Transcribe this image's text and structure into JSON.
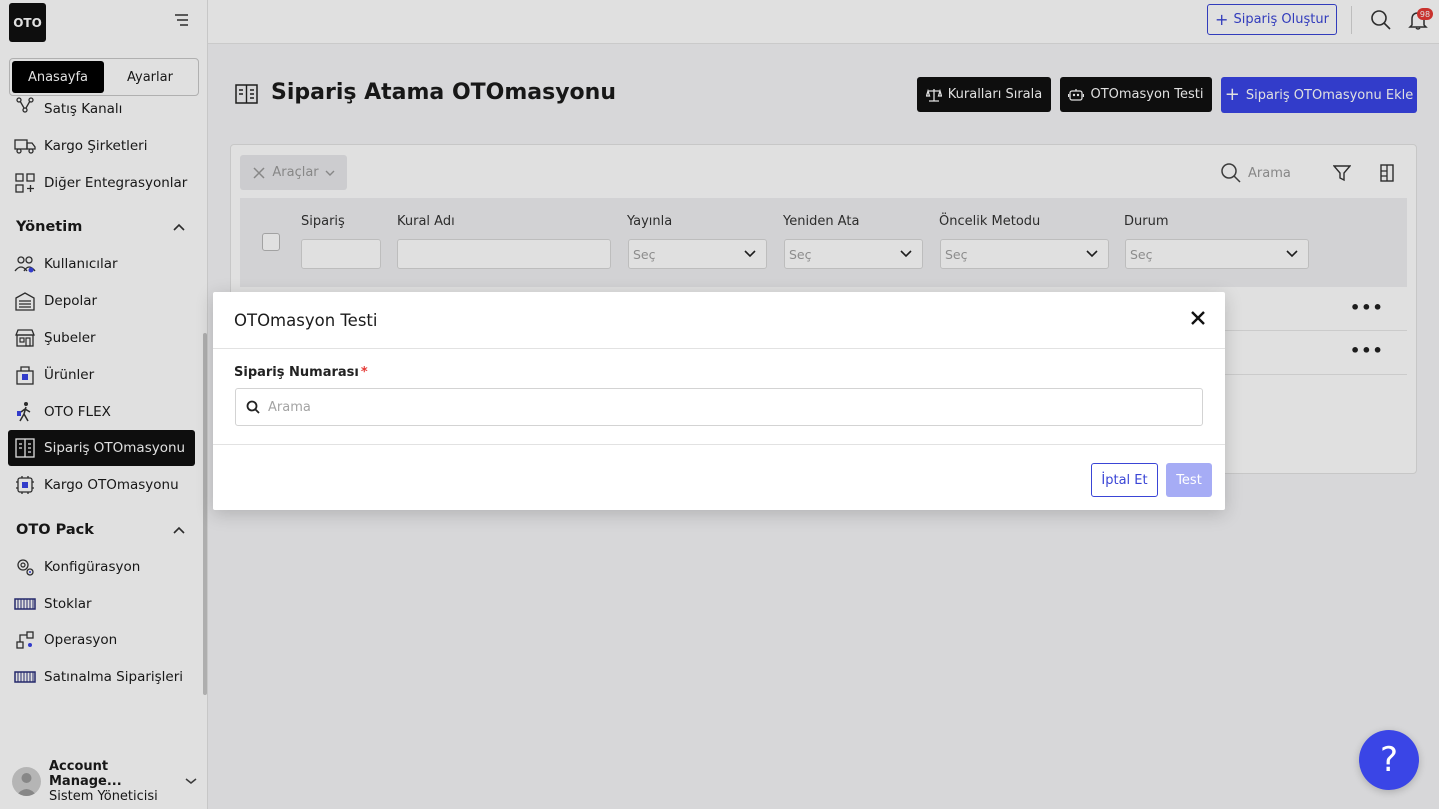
{
  "app": {
    "logo_text": "OTO"
  },
  "sidebar": {
    "tabs": [
      {
        "label": "Anasayfa",
        "active": true
      },
      {
        "label": "Ayarlar",
        "active": false
      }
    ],
    "items_top": [
      {
        "label": "Satış Kanalı",
        "icon": "channel-icon"
      },
      {
        "label": "Kargo Şirketleri",
        "icon": "truck-icon"
      },
      {
        "label": "Diğer Entegrasyonlar",
        "icon": "grid-plus-icon"
      }
    ],
    "section_management": "Yönetim",
    "items_management": [
      {
        "label": "Kullanıcılar",
        "icon": "users-icon"
      },
      {
        "label": "Depolar",
        "icon": "warehouse-icon"
      },
      {
        "label": "Şubeler",
        "icon": "store-icon"
      },
      {
        "label": "Ürünler",
        "icon": "products-icon"
      },
      {
        "label": "OTO FLEX",
        "icon": "flex-icon"
      },
      {
        "label": "Sipariş OTOmasyonu",
        "icon": "order-automation-icon",
        "active": true
      },
      {
        "label": "Kargo OTOmasyonu",
        "icon": "cargo-automation-icon"
      }
    ],
    "section_pack": "OTO Pack",
    "items_pack": [
      {
        "label": "Konfigürasyon",
        "icon": "config-icon"
      },
      {
        "label": "Stoklar",
        "icon": "stock-icon"
      },
      {
        "label": "Operasyon",
        "icon": "operation-icon"
      },
      {
        "label": "Satınalma Siparişleri",
        "icon": "purchase-icon"
      }
    ],
    "account": {
      "name": "Account Manage...",
      "role": "Sistem Yöneticisi"
    }
  },
  "topbar": {
    "create_order_label": "Sipariş Oluştur",
    "notification_count": "98"
  },
  "page": {
    "title": "Sipariş Atama OTOmasyonu",
    "btn_sort_rules": "Kuralları Sırala",
    "btn_automation_test": "OTOmasyon Testi",
    "btn_add_automation": "Sipariş OTOmasyonu Ekle"
  },
  "table": {
    "tools_label": "Araçlar",
    "search_placeholder": "Arama",
    "columns": [
      "Sipariş",
      "Kural Adı",
      "Yayınla",
      "Yeniden Ata",
      "Öncelik Metodu",
      "Durum"
    ],
    "select_placeholder": "Seç"
  },
  "modal": {
    "title": "OTOmasyon Testi",
    "field_label": "Sipariş Numarası",
    "required_mark": "*",
    "input_placeholder": "Arama",
    "cancel_label": "İptal Et",
    "test_label": "Test"
  },
  "help": {
    "label": "?"
  },
  "colors": {
    "accent": "#3a45e6",
    "dark": "#111111",
    "danger": "#e53935"
  }
}
